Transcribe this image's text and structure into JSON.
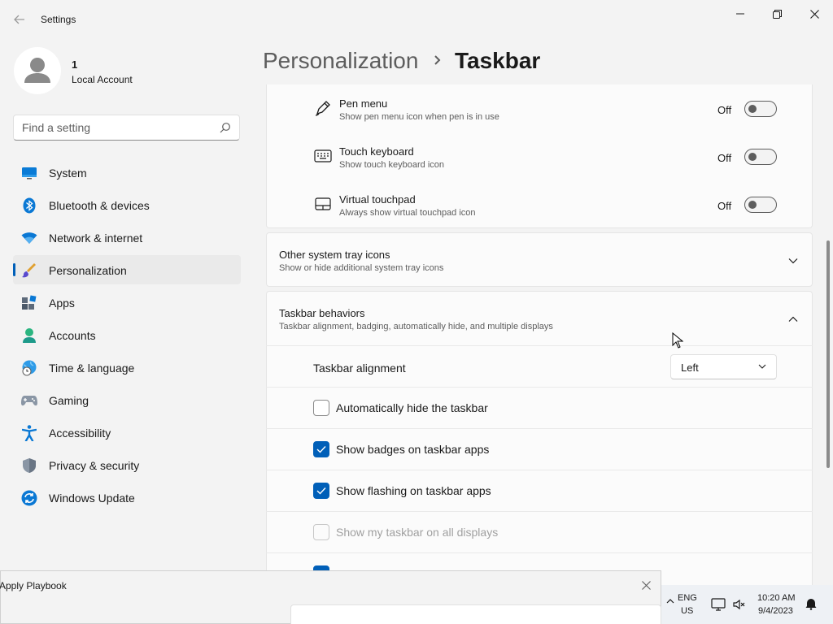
{
  "window": {
    "title": "Settings"
  },
  "account": {
    "name": "1",
    "type": "Local Account"
  },
  "search": {
    "placeholder": "Find a setting"
  },
  "nav": {
    "items": [
      {
        "label": "System",
        "icon": "system-icon"
      },
      {
        "label": "Bluetooth & devices",
        "icon": "bluetooth-icon"
      },
      {
        "label": "Network & internet",
        "icon": "wifi-icon"
      },
      {
        "label": "Personalization",
        "icon": "brush-icon",
        "selected": true
      },
      {
        "label": "Apps",
        "icon": "apps-icon"
      },
      {
        "label": "Accounts",
        "icon": "person-icon"
      },
      {
        "label": "Time & language",
        "icon": "globe-clock-icon"
      },
      {
        "label": "Gaming",
        "icon": "gamepad-icon"
      },
      {
        "label": "Accessibility",
        "icon": "accessibility-icon"
      },
      {
        "label": "Privacy & security",
        "icon": "shield-icon"
      },
      {
        "label": "Windows Update",
        "icon": "update-icon"
      }
    ]
  },
  "breadcrumb": {
    "parent": "Personalization",
    "separator": "›",
    "current": "Taskbar"
  },
  "tray_icons": {
    "rows": [
      {
        "title": "Pen menu",
        "subtitle": "Show pen menu icon when pen is in use",
        "state": "Off",
        "icon": "pen-icon"
      },
      {
        "title": "Touch keyboard",
        "subtitle": "Show touch keyboard icon",
        "state": "Off",
        "icon": "keyboard-icon"
      },
      {
        "title": "Virtual touchpad",
        "subtitle": "Always show virtual touchpad icon",
        "state": "Off",
        "icon": "touchpad-icon"
      }
    ]
  },
  "other_tray": {
    "title": "Other system tray icons",
    "subtitle": "Show or hide additional system tray icons"
  },
  "behaviors": {
    "title": "Taskbar behaviors",
    "subtitle": "Taskbar alignment, badging, automatically hide, and multiple displays",
    "alignment_label": "Taskbar alignment",
    "alignment_value": "Left",
    "options": [
      {
        "label": "Automatically hide the taskbar",
        "checked": false,
        "disabled": false
      },
      {
        "label": "Show badges on taskbar apps",
        "checked": true,
        "disabled": false
      },
      {
        "label": "Show flashing on taskbar apps",
        "checked": true,
        "disabled": false
      },
      {
        "label": "Show my taskbar on all displays",
        "checked": false,
        "disabled": true
      }
    ]
  },
  "playbook": {
    "title": "Apply Playbook"
  },
  "taskbar": {
    "lang_line1": "ENG",
    "lang_line2": "US",
    "time": "10:20 AM",
    "date": "9/4/2023"
  },
  "colors": {
    "accent": "#005fb8",
    "background": "#f3f3f3",
    "card": "#fbfbfb"
  }
}
